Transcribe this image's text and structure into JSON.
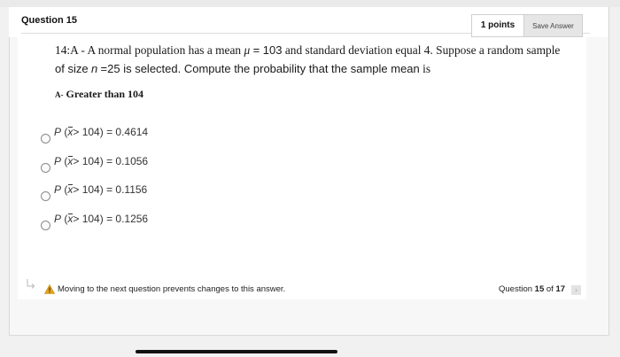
{
  "question": {
    "title": "Question 15",
    "points": "1 points",
    "save_label": "Save Answer"
  },
  "prompt": {
    "lead": "14:A - A normal population has a mean",
    "mu_symbol": "μ",
    "mu_value": "= 103",
    "mid": "and standard deviation equal 4.  Suppose a random sample",
    "of_size": "of size",
    "n_symbol": "n",
    "n_value": "=25 is selected. Compute the probability that the sample mean",
    "tail": "is"
  },
  "sub_question": {
    "letter": "A-",
    "text": "Greater than 104"
  },
  "options": [
    {
      "p": "P",
      "open": "(",
      "xbar": "x",
      "relation": "> 104)",
      "equals": "= 0.4614",
      "selected": false
    },
    {
      "p": "P",
      "open": "(",
      "xbar": "x",
      "relation": "> 104)",
      "equals": "= 0.1056",
      "selected": false
    },
    {
      "p": "P",
      "open": "(",
      "xbar": "x",
      "relation": "> 104)",
      "equals": "= 0.1156",
      "selected": false
    },
    {
      "p": "P",
      "open": "(",
      "xbar": "x",
      "relation": "> 104)",
      "equals": "= 0.1256",
      "selected": false
    }
  ],
  "footer": {
    "warning": "Moving to the next question prevents changes to this answer.",
    "progress_prefix": "Question",
    "current": "15",
    "of": "of",
    "total": "17",
    "next_symbol": "›"
  },
  "colors": {
    "background": "#f1f1f1",
    "card": "#ffffff",
    "warning": "#e8a317",
    "button": "#e6e6e6"
  },
  "icons": [
    "arrow-return-icon",
    "warning-icon",
    "radio-icon",
    "chevron-right-icon"
  ]
}
